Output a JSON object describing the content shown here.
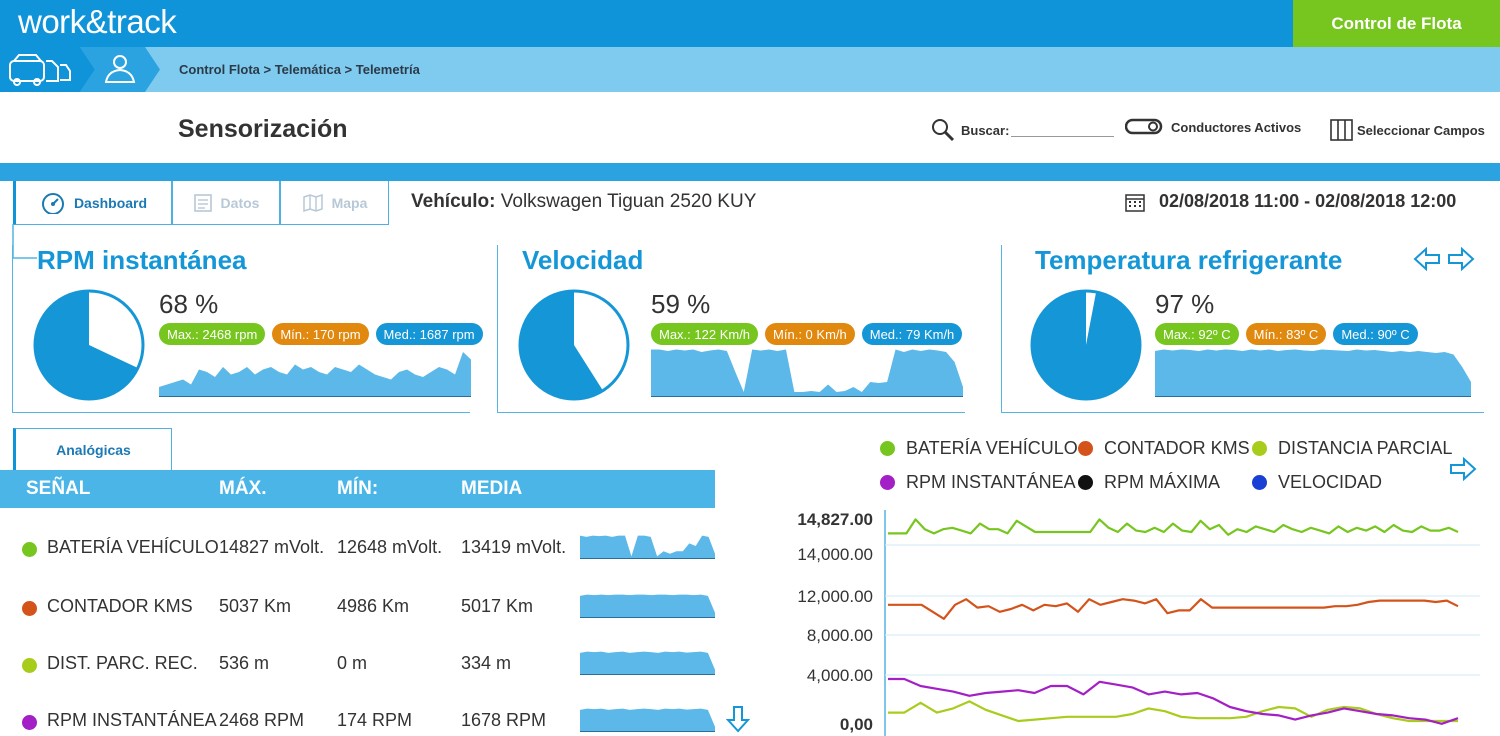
{
  "app": {
    "logo": "work&track",
    "fleet_button": "Control de Flota",
    "breadcrumb": "Control Flota > Telemática > Telemetría",
    "colors": {
      "primary": "#0f93d9",
      "accent_green": "#77c61f",
      "orange": "#e1880f"
    }
  },
  "header": {
    "title": "Sensorización",
    "search_label": "Buscar:",
    "drivers_toggle": "Conductores Activos",
    "select_fields": "Seleccionar Campos"
  },
  "tabs": [
    {
      "label": "Dashboard",
      "icon": "gauge-icon"
    },
    {
      "label": "Datos",
      "icon": "document-icon"
    },
    {
      "label": "Mapa",
      "icon": "map-icon"
    }
  ],
  "vehicle": {
    "label": "Vehículo:",
    "name": "Volkswagen Tiguan 2520 KUY"
  },
  "date_range": "02/08/2018 11:00 - 02/08/2018 12:00",
  "gauges": [
    {
      "title": "RPM instantánea",
      "percent_label": "68 %",
      "percent": 68,
      "max": "Max.: 2468 rpm",
      "min": "Mín.: 170 rpm",
      "med": "Med.: 1687 rpm",
      "spark": [
        0.2,
        0.25,
        0.3,
        0.35,
        0.25,
        0.55,
        0.5,
        0.4,
        0.6,
        0.45,
        0.5,
        0.6,
        0.45,
        0.55,
        0.6,
        0.5,
        0.45,
        0.65,
        0.55,
        0.6,
        0.5,
        0.45,
        0.6,
        0.55,
        0.5,
        0.65,
        0.55,
        0.45,
        0.4,
        0.35,
        0.5,
        0.55,
        0.45,
        0.4,
        0.5,
        0.6,
        0.55,
        0.45,
        0.9,
        0.75
      ]
    },
    {
      "title": "Velocidad",
      "percent_label": "59 %",
      "percent": 59,
      "max": "Max.: 122 Km/h",
      "min": "Mín.: 0 Km/h",
      "med": "Med.: 79 Km/h",
      "spark": [
        0.95,
        0.95,
        0.92,
        0.95,
        0.93,
        0.95,
        0.9,
        0.93,
        0.95,
        0.92,
        0.5,
        0.1,
        0.95,
        0.93,
        0.95,
        0.92,
        0.95,
        0.1,
        0.1,
        0.12,
        0.1,
        0.25,
        0.1,
        0.12,
        0.2,
        0.1,
        0.3,
        0.28,
        0.3,
        0.95,
        0.9,
        0.95,
        0.92,
        0.95,
        0.93,
        0.9,
        0.7,
        0.2
      ]
    },
    {
      "title": "Temperatura refrigerante",
      "percent_label": "97 %",
      "percent": 97,
      "max": "Max.: 92º C",
      "min": "Mín.: 83º C",
      "med": "Med.: 90º C",
      "spark": [
        0.92,
        0.95,
        0.93,
        0.95,
        0.94,
        0.92,
        0.95,
        0.93,
        0.95,
        0.94,
        0.92,
        0.95,
        0.93,
        0.95,
        0.92,
        0.94,
        0.95,
        0.93,
        0.92,
        0.95,
        0.94,
        0.93,
        0.92,
        0.95,
        0.93,
        0.94,
        0.92,
        0.9,
        0.92,
        0.9,
        0.92,
        0.9,
        0.88,
        0.9,
        0.85,
        0.6,
        0.3
      ]
    }
  ],
  "table": {
    "tab": "Analógicas",
    "headers": [
      "SEÑAL",
      "MÁX.",
      "MÍN:",
      "MEDIA"
    ],
    "rows": [
      {
        "name": "BATERÍA VEHÍCULO",
        "max": "14827 mVolt.",
        "min": "12648 mVolt.",
        "media": "13419 mVolt.",
        "color": "#77c61f",
        "spark": [
          0.9,
          0.85,
          0.9,
          0.88,
          0.9,
          0.85,
          0.9,
          0.9,
          0.1,
          0.9,
          0.9,
          0.85,
          0.1,
          0.3,
          0.2,
          0.3,
          0.3,
          0.6,
          0.5,
          0.9,
          0.85,
          0.2
        ]
      },
      {
        "name": "CONTADOR KMS",
        "max": "5037 Km",
        "min": "4986 Km",
        "media": "5017 Km",
        "color": "#d4531b",
        "spark": [
          0.85,
          0.9,
          0.88,
          0.9,
          0.88,
          0.9,
          0.9,
          0.88,
          0.9,
          0.9,
          0.88,
          0.9,
          0.9,
          0.88,
          0.9,
          0.9,
          0.88,
          0.9,
          0.85,
          0.2
        ]
      },
      {
        "name": "DIST. PARC. REC.",
        "max": "536 m",
        "min": "0 m",
        "media": "334 m",
        "color": "#a8cc1c",
        "spark": [
          0.85,
          0.9,
          0.88,
          0.9,
          0.85,
          0.88,
          0.9,
          0.85,
          0.88,
          0.9,
          0.88,
          0.85,
          0.9,
          0.88,
          0.9,
          0.86,
          0.88,
          0.9,
          0.85,
          0.2
        ]
      },
      {
        "name": "RPM INSTANTÁNEA",
        "max": "2468 RPM",
        "min": "174 RPM",
        "media": "1678 RPM",
        "color": "#a31fc6",
        "spark": [
          0.85,
          0.9,
          0.88,
          0.9,
          0.85,
          0.88,
          0.9,
          0.85,
          0.88,
          0.9,
          0.88,
          0.85,
          0.9,
          0.88,
          0.9,
          0.86,
          0.88,
          0.9,
          0.85,
          0.2
        ]
      }
    ]
  },
  "chart_data": {
    "type": "line",
    "legend": [
      {
        "name": "BATERÍA VEHÍCULO",
        "color": "#77c61f"
      },
      {
        "name": "CONTADOR KMS",
        "color": "#d4531b"
      },
      {
        "name": "DISTANCIA PARCIAL",
        "color": "#a8cc1c"
      },
      {
        "name": "RPM INSTANTÁNEA",
        "color": "#a31fc6"
      },
      {
        "name": "RPM MÁXIMA",
        "color": "#111111"
      },
      {
        "name": "VELOCIDAD",
        "color": "#1a3fd4"
      }
    ],
    "y_ticks": [
      "14,827.00",
      "14,000.00",
      "12,000.00",
      "8,000.00",
      "4,000.00",
      "0,00"
    ],
    "series": [
      {
        "name": "BATERÍA VEHÍCULO",
        "color": "#77c61f",
        "values": [
          13900,
          13900,
          13900,
          14900,
          14200,
          13900,
          14200,
          14300,
          14100,
          13900,
          14600,
          14200,
          14200,
          13900,
          14800,
          14400,
          14000,
          14000,
          14000,
          14000,
          14000,
          14000,
          14000,
          14900,
          14300,
          14000,
          14600,
          14100,
          14000,
          14300,
          14000,
          14600,
          14100,
          14000,
          14800,
          14200,
          14500,
          13800,
          14200,
          14000,
          14400,
          14200,
          14000,
          14500,
          14200,
          14000,
          14300,
          14100,
          13900,
          14400,
          14000,
          14300,
          14100,
          14400,
          14000,
          14500,
          14100,
          14000,
          14400,
          14100,
          14100,
          14300,
          14000
        ]
      },
      {
        "name": "CONTADOR KMS",
        "color": "#d4531b",
        "values": [
          8800,
          8800,
          8800,
          8800,
          8300,
          7800,
          8800,
          9200,
          8600,
          8700,
          8300,
          8500,
          8800,
          8400,
          8800,
          8700,
          8900,
          8300,
          9200,
          8800,
          9000,
          9200,
          9100,
          8900,
          9200,
          8200,
          8400,
          8400,
          9200,
          8600,
          8600,
          8600,
          8600,
          8600,
          8600,
          8600,
          8600,
          8600,
          8600,
          8600,
          8700,
          8700,
          8800,
          9000,
          9100,
          9100,
          9100,
          9100,
          9100,
          9000,
          9100,
          8700
        ]
      },
      {
        "name": "DISTANCIA PARCIAL",
        "color": "#a8cc1c",
        "values": [
          1100,
          1100,
          1800,
          1100,
          1400,
          1900,
          1300,
          900,
          500,
          600,
          700,
          800,
          800,
          800,
          800,
          1000,
          1400,
          1200,
          800,
          700,
          700,
          700,
          800,
          1200,
          1500,
          1400,
          800,
          1300,
          1500,
          1400,
          1000,
          700,
          500,
          500,
          500,
          500
        ]
      },
      {
        "name": "RPM INSTANTÁNEA",
        "color": "#a31fc6",
        "values": [
          3500,
          3500,
          3000,
          2800,
          2600,
          2300,
          2500,
          2600,
          2700,
          2500,
          3000,
          3000,
          2400,
          3300,
          3100,
          2900,
          2400,
          2600,
          2400,
          2500,
          2100,
          1500,
          1200,
          1000,
          900,
          600,
          900,
          1100,
          1400,
          1200,
          1000,
          900,
          700,
          600,
          300,
          700
        ]
      }
    ],
    "ylim": [
      0,
      15000
    ]
  }
}
